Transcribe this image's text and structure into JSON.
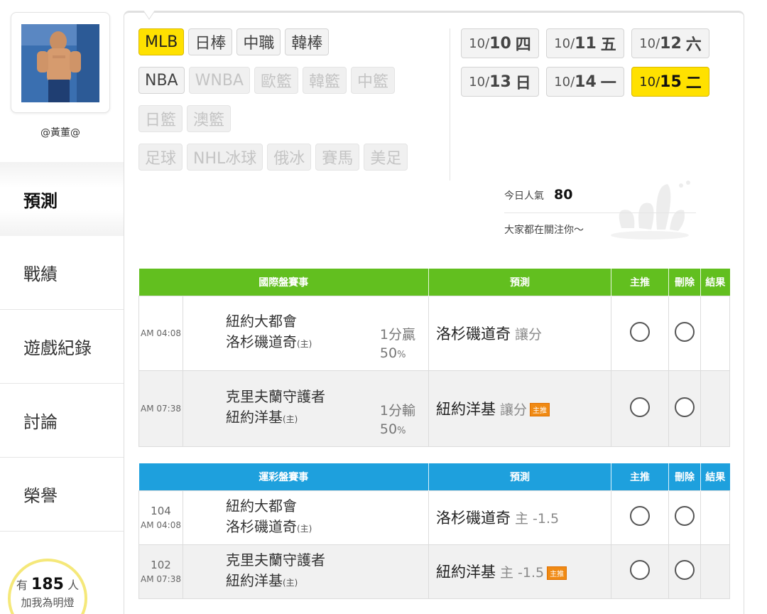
{
  "user": {
    "name": "@黃董@"
  },
  "nav": {
    "items": [
      {
        "label": "預測",
        "active": true
      },
      {
        "label": "戰績"
      },
      {
        "label": "遊戲紀錄"
      },
      {
        "label": "討論"
      },
      {
        "label": "榮譽"
      }
    ]
  },
  "fans": {
    "prefix": "有",
    "count": "185",
    "suffix": "人",
    "action": "加我為明燈"
  },
  "sports": {
    "rows": [
      [
        {
          "label": "MLB",
          "state": "selected"
        },
        {
          "label": "日棒",
          "state": "normal"
        },
        {
          "label": "中職",
          "state": "normal"
        },
        {
          "label": "韓棒",
          "state": "normal"
        }
      ],
      [
        {
          "label": "NBA",
          "state": "normal"
        },
        {
          "label": "WNBA",
          "state": "disabled"
        },
        {
          "label": "歐籃",
          "state": "disabled"
        },
        {
          "label": "韓籃",
          "state": "disabled"
        },
        {
          "label": "中籃",
          "state": "disabled"
        }
      ],
      [
        {
          "label": "日籃",
          "state": "disabled"
        },
        {
          "label": "澳籃",
          "state": "disabled"
        }
      ],
      [
        {
          "label": "足球",
          "state": "disabled"
        },
        {
          "label": "NHL冰球",
          "state": "disabled"
        },
        {
          "label": "俄冰",
          "state": "disabled"
        },
        {
          "label": "賽馬",
          "state": "disabled"
        },
        {
          "label": "美足",
          "state": "disabled"
        }
      ]
    ]
  },
  "dates": [
    {
      "month": "10/",
      "day": "10",
      "weekday": "四"
    },
    {
      "month": "10/",
      "day": "11",
      "weekday": "五"
    },
    {
      "month": "10/",
      "day": "12",
      "weekday": "六"
    },
    {
      "month": "10/",
      "day": "13",
      "weekday": "日"
    },
    {
      "month": "10/",
      "day": "14",
      "weekday": "一"
    },
    {
      "month": "10/",
      "day": "15",
      "weekday": "二",
      "selected": true
    }
  ],
  "popularity": {
    "label": "今日人氣",
    "count": "80",
    "message": "大家都在關注你～"
  },
  "intl": {
    "headers": [
      "國際盤賽事",
      "預測",
      "主推",
      "刪除",
      "結果"
    ],
    "rows": [
      {
        "time": "AM 04:08",
        "away": "紐約大都會",
        "home": "洛杉磯道奇",
        "home_tag": "(主)",
        "odds": "1分贏",
        "pct_num": "50",
        "pct_sym": "%",
        "pick": "洛杉磯道奇",
        "pick_type": "讓分",
        "tag": ""
      },
      {
        "time": "AM 07:38",
        "away": "克里夫蘭守護者",
        "home": "紐約洋基",
        "home_tag": "(主)",
        "odds": "1分輸",
        "pct_num": "50",
        "pct_sym": "%",
        "pick": "紐約洋基",
        "pick_type": "讓分",
        "tag": "主推"
      }
    ]
  },
  "lottery": {
    "headers": [
      "運彩盤賽事",
      "預測",
      "主推",
      "刪除",
      "結果"
    ],
    "rows": [
      {
        "code": "104",
        "time": "AM 04:08",
        "away": "紐約大都會",
        "home": "洛杉磯道奇",
        "home_tag": "(主)",
        "pick": "洛杉磯道奇",
        "pick_type": "主 -1.5",
        "tag": ""
      },
      {
        "code": "102",
        "time": "AM 07:38",
        "away": "克里夫蘭守護者",
        "home": "紐約洋基",
        "home_tag": "(主)",
        "pick": "紐約洋基",
        "pick_type": "主 -1.5",
        "tag": "主推"
      }
    ]
  },
  "colors": {
    "green_header": "#62bf1f",
    "blue_header": "#1ea0dd",
    "selected_yellow": "#ffe100",
    "tag_orange": "#f08a14"
  }
}
